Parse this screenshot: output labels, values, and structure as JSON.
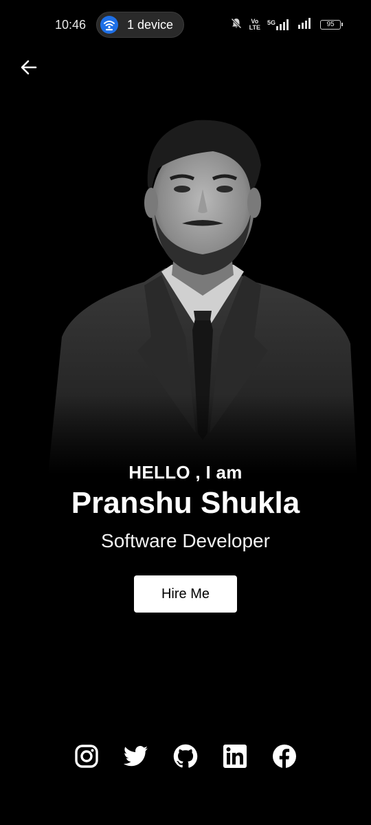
{
  "status_bar": {
    "time": "10:46",
    "device_pill_label": "1 device",
    "battery_level": "95",
    "volte_top": "Vo",
    "volte_bottom": "LTE",
    "network": "5G"
  },
  "hero": {
    "greeting": "HELLO , I am",
    "name": "Pranshu Shukla",
    "role": "Software Developer",
    "hire_label": "Hire Me"
  },
  "social": {
    "icons": [
      "instagram-icon",
      "twitter-icon",
      "github-icon",
      "linkedin-icon",
      "facebook-icon"
    ]
  },
  "colors": {
    "background": "#000000",
    "text": "#ffffff",
    "button_bg": "#ffffff",
    "button_text": "#000000",
    "wifi_accent": "#1e6fe6"
  }
}
